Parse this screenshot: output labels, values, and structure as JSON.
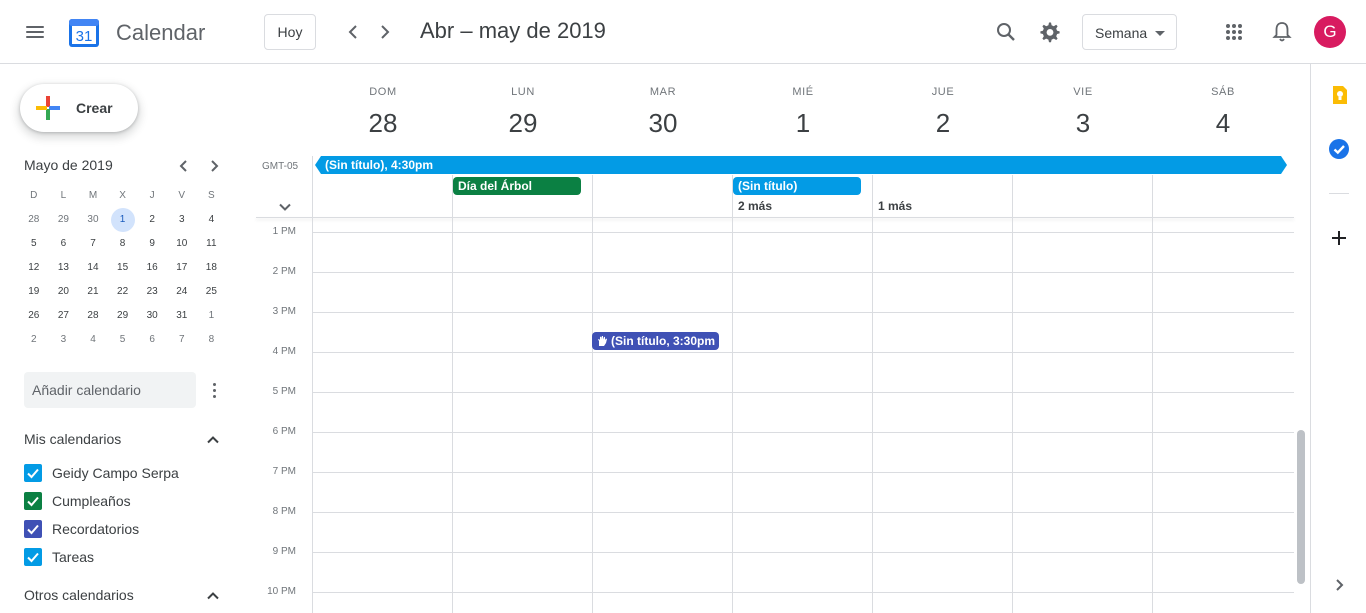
{
  "header": {
    "logo_day": "31",
    "app_name": "Calendar",
    "today_label": "Hoy",
    "date_range": "Abr – may de 2019",
    "view_label": "Semana",
    "avatar_letter": "G"
  },
  "create": {
    "label": "Crear"
  },
  "mini_calendar": {
    "title": "Mayo de 2019",
    "weekdays": [
      "D",
      "L",
      "M",
      "X",
      "J",
      "V",
      "S"
    ],
    "weeks": [
      [
        {
          "d": "28",
          "o": true
        },
        {
          "d": "29",
          "o": true
        },
        {
          "d": "30",
          "o": true
        },
        {
          "d": "1",
          "sel": true
        },
        {
          "d": "2"
        },
        {
          "d": "3"
        },
        {
          "d": "4"
        }
      ],
      [
        {
          "d": "5"
        },
        {
          "d": "6"
        },
        {
          "d": "7"
        },
        {
          "d": "8"
        },
        {
          "d": "9"
        },
        {
          "d": "10"
        },
        {
          "d": "11"
        }
      ],
      [
        {
          "d": "12"
        },
        {
          "d": "13"
        },
        {
          "d": "14"
        },
        {
          "d": "15"
        },
        {
          "d": "16"
        },
        {
          "d": "17"
        },
        {
          "d": "18"
        }
      ],
      [
        {
          "d": "19"
        },
        {
          "d": "20"
        },
        {
          "d": "21"
        },
        {
          "d": "22"
        },
        {
          "d": "23"
        },
        {
          "d": "24"
        },
        {
          "d": "25"
        }
      ],
      [
        {
          "d": "26"
        },
        {
          "d": "27"
        },
        {
          "d": "28"
        },
        {
          "d": "29"
        },
        {
          "d": "30"
        },
        {
          "d": "31"
        },
        {
          "d": "1",
          "o": true
        }
      ],
      [
        {
          "d": "2",
          "o": true
        },
        {
          "d": "3",
          "o": true
        },
        {
          "d": "4",
          "o": true
        },
        {
          "d": "5",
          "o": true
        },
        {
          "d": "6",
          "o": true
        },
        {
          "d": "7",
          "o": true
        },
        {
          "d": "8",
          "o": true
        }
      ]
    ]
  },
  "add_calendar": {
    "placeholder": "Añadir calendario"
  },
  "my_calendars": {
    "title": "Mis calendarios",
    "items": [
      {
        "label": "Geidy Campo Serpa",
        "color": "#039be5"
      },
      {
        "label": "Cumpleaños",
        "color": "#0b8043"
      },
      {
        "label": "Recordatorios",
        "color": "#3f51b5"
      },
      {
        "label": "Tareas",
        "color": "#039be5"
      }
    ]
  },
  "other_calendars": {
    "title": "Otros calendarios"
  },
  "week": {
    "timezone": "GMT-05",
    "days": [
      {
        "name": "DOM",
        "num": "28"
      },
      {
        "name": "LUN",
        "num": "29"
      },
      {
        "name": "MAR",
        "num": "30"
      },
      {
        "name": "MIÉ",
        "num": "1"
      },
      {
        "name": "JUE",
        "num": "2"
      },
      {
        "name": "VIE",
        "num": "3"
      },
      {
        "name": "SÁB",
        "num": "4"
      }
    ],
    "hours": [
      "1 PM",
      "2 PM",
      "3 PM",
      "4 PM",
      "5 PM",
      "6 PM",
      "7 PM",
      "8 PM",
      "9 PM",
      "10 PM"
    ]
  },
  "events": {
    "allday_bar": {
      "label": "(Sin título), 4:30pm",
      "color": "#039be5"
    },
    "arbor_day": {
      "label": "Día del Árbol",
      "color": "#0b8043"
    },
    "untitled_wed": {
      "label": "(Sin título)",
      "color": "#039be5"
    },
    "more_wed": "2 más",
    "more_thu": "1 más",
    "reminder_tue": {
      "label": "(Sin título, 3:30pm",
      "color": "#3f51b5"
    }
  },
  "icons": [
    "menu-icon",
    "calendar-logo-icon",
    "chevron-left-icon",
    "chevron-right-icon",
    "search-icon",
    "gear-icon",
    "apps-grid-icon",
    "bell-icon",
    "keep-icon",
    "tasks-icon",
    "add-icon",
    "expand-icon"
  ]
}
